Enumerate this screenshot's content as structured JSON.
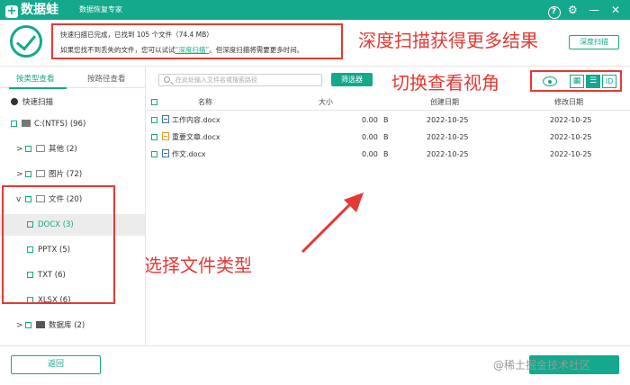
{
  "app": {
    "logo_glyph": "+",
    "name": "数据蛙",
    "subtitle": "数据恢复专家",
    "help_icon": "?",
    "settings_icon": "⚙",
    "minimize_icon": "—",
    "close_icon": "✕"
  },
  "status": {
    "line1": "快速扫描已完成，已找到 105 个文件（74.4 MB）",
    "line2_prefix": "如果您找不到丢失的文件，您可以试试",
    "line2_link": "“深度扫描”",
    "line2_suffix": "。但深度扫描将需要更多时间。",
    "deep_scan_button": "深度扫描"
  },
  "annotations": {
    "deep_scan": "深度扫描获得更多结果",
    "switch_view": "切换查看视角",
    "select_type": "选择文件类型"
  },
  "sidebar": {
    "tab_type": "按类型查看",
    "tab_path": "按路径查看",
    "quick_scan": "快速扫描",
    "drive": "C:(NTFS) (96)",
    "items": [
      {
        "label": "其他 (2)"
      },
      {
        "label": "图片 (72)"
      },
      {
        "label": "文件 (20)"
      },
      {
        "label": "DOCX (3)"
      },
      {
        "label": "PPTX (5)"
      },
      {
        "label": "TXT (6)"
      },
      {
        "label": "XLSX (6)"
      },
      {
        "label": "数据库 (2)"
      }
    ]
  },
  "toolbar": {
    "search_placeholder": "在此处输入文件名或搜索路径",
    "filter_button": "筛选器",
    "view_grid": "▦",
    "view_list": "☰",
    "view_detail": "ID"
  },
  "table": {
    "headers": {
      "name": "名称",
      "size": "大小",
      "created": "创建日期",
      "modified": "修改日期"
    },
    "rows": [
      {
        "name": "工作内容.docx",
        "size": "0.00",
        "unit": "B",
        "created": "2022-10-25",
        "modified": "2022-10-25"
      },
      {
        "name": "重要文章.docx",
        "size": "0.00",
        "unit": "B",
        "created": "2022-10-25",
        "modified": "2022-10-25"
      },
      {
        "name": "作文.docx",
        "size": "0.00",
        "unit": "B",
        "created": "2022-10-25",
        "modified": "2022-10-25"
      }
    ]
  },
  "footer": {
    "back_button": "返回",
    "watermark": "@稀土掘金技术社区"
  },
  "colors": {
    "accent": "#14a88c",
    "annotation": "#e53935"
  }
}
